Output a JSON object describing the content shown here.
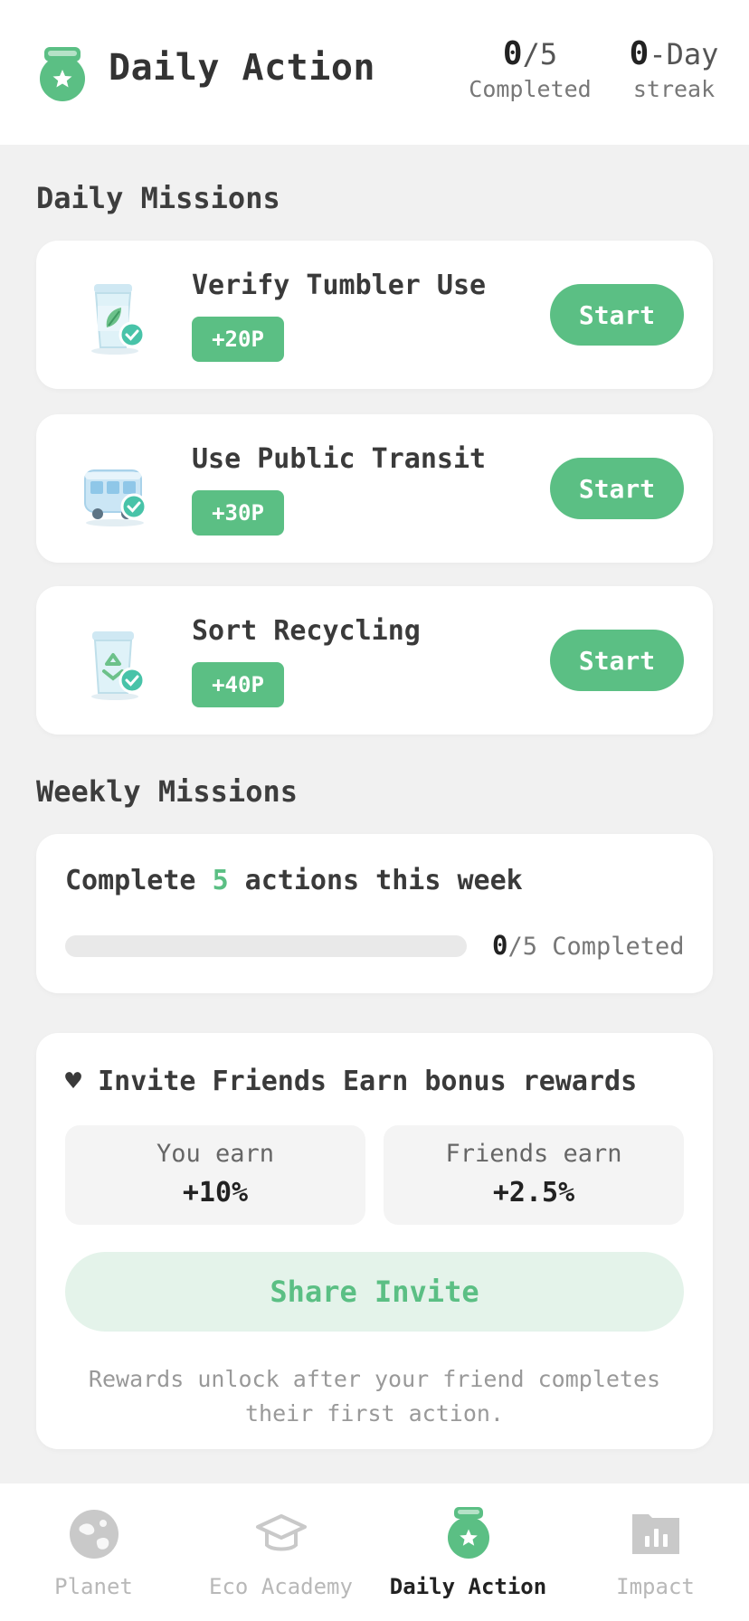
{
  "header": {
    "title": "Daily Action",
    "completed": {
      "value": "0",
      "total": "/5",
      "label": "Completed"
    },
    "streak": {
      "value": "0",
      "suffix": "-Day",
      "label": "streak"
    }
  },
  "daily": {
    "section_title": "Daily Missions",
    "missions": [
      {
        "title": "Verify Tumbler Use",
        "points": "+20P",
        "button": "Start",
        "icon": "tumbler-icon"
      },
      {
        "title": "Use Public Transit",
        "points": "+30P",
        "button": "Start",
        "icon": "bus-icon"
      },
      {
        "title": "Sort Recycling",
        "points": "+40P",
        "button": "Start",
        "icon": "recycling-bin-icon"
      }
    ]
  },
  "weekly": {
    "section_title": "Weekly Missions",
    "title_prefix": "Complete ",
    "title_number": "5",
    "title_suffix": " actions this week",
    "progress_value": "0",
    "progress_total": "/5 Completed",
    "progress_fraction": 0
  },
  "invite": {
    "title": "♥ Invite Friends Earn bonus rewards",
    "you_label": "You earn",
    "you_value": "+10%",
    "friends_label": "Friends earn",
    "friends_value": "+2.5%",
    "share_button": "Share Invite",
    "note": "Rewards unlock after your friend completes their first action."
  },
  "tabs": [
    {
      "label": "Planet",
      "icon": "planet-icon",
      "active": false
    },
    {
      "label": "Eco Academy",
      "icon": "graduation-cap-icon",
      "active": false
    },
    {
      "label": "Daily Action",
      "icon": "daily-action-icon",
      "active": true
    },
    {
      "label": "Impact",
      "icon": "bar-chart-icon",
      "active": false
    }
  ],
  "colors": {
    "accent": "#5bbf84",
    "accent_light": "#e4f3ea",
    "background": "#f1f1f1"
  }
}
